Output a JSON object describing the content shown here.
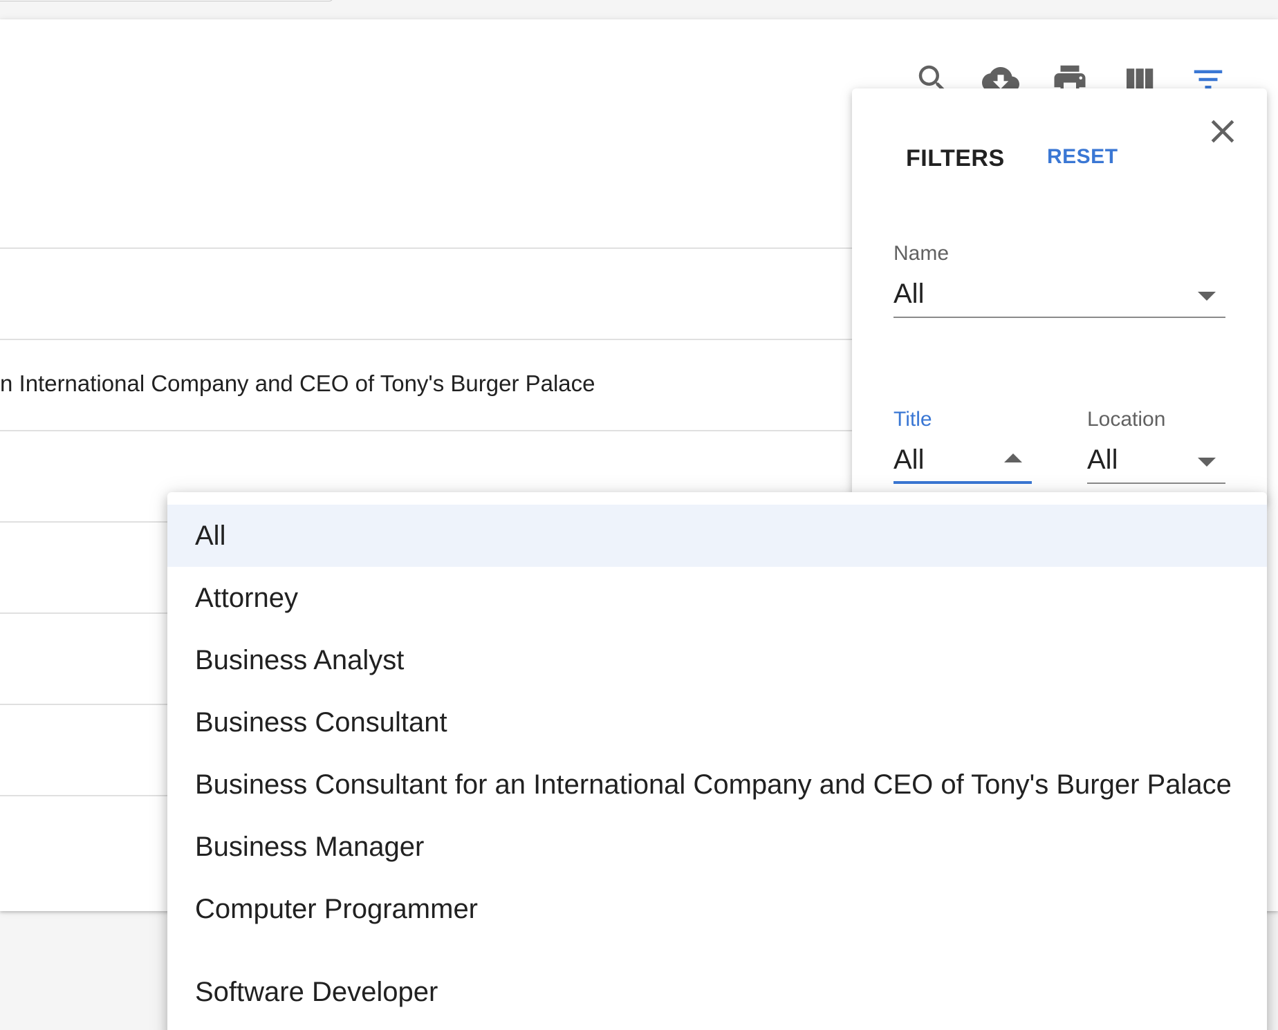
{
  "toolbar": {
    "icons": [
      "search-icon",
      "cloud-download-icon",
      "print-icon",
      "view-column-icon",
      "filter-list-icon"
    ],
    "active_color": "#3a77d4",
    "icon_color": "#616161"
  },
  "table": {
    "visible_row_text": "n International Company and CEO of Tony's Burger Palace"
  },
  "filters": {
    "title": "FILTERS",
    "reset_label": "RESET",
    "name": {
      "label": "Name",
      "value": "All"
    },
    "title_field": {
      "label": "Title",
      "value": "All"
    },
    "location": {
      "label": "Location",
      "value": "All"
    }
  },
  "title_menu": {
    "options": [
      "All",
      "Attorney",
      "Business Analyst",
      "Business Consultant",
      "Business Consultant for an International Company and CEO of Tony's Burger Palace",
      "Business Manager",
      "Computer Programmer",
      "Software Developer"
    ],
    "selected": "All"
  }
}
